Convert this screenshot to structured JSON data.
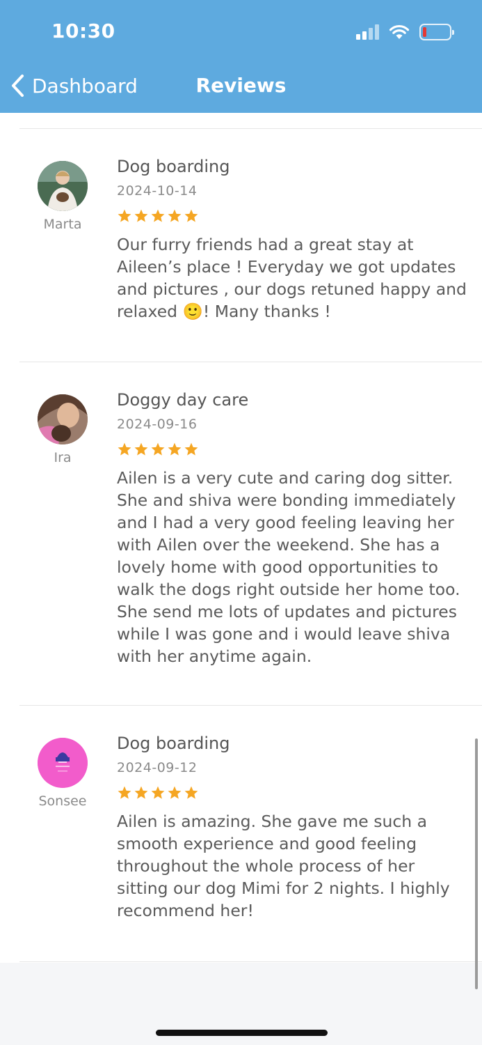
{
  "colors": {
    "accent": "#5eaadf",
    "star": "#f5a623"
  },
  "status_bar": {
    "time": "10:30",
    "icons": [
      "cellular-signal-icon",
      "wifi-icon",
      "battery-low-icon"
    ]
  },
  "nav": {
    "back_label": "Dashboard",
    "title": "Reviews"
  },
  "reviews": [
    {
      "name": "Marta",
      "service": "Dog boarding",
      "date": "2024-10-14",
      "rating": 5,
      "text": "Our furry friends had a great stay at Aileen’s place ! Everyday we got updates and  pictures , our dogs retuned happy and relaxed 🙂!  Many thanks !"
    },
    {
      "name": "Ira",
      "service": "Doggy day care",
      "date": "2024-09-16",
      "rating": 5,
      "text": "Ailen is a very cute and caring dog sitter. She and shiva were bonding immediately and I had a very good feeling leaving her with Ailen over the weekend. She has a lovely home with good opportunities to walk the dogs right outside her home too. She send me lots of updates and pictures while I was gone and i would leave shiva with her anytime again."
    },
    {
      "name": "Sonsee",
      "service": "Dog boarding",
      "date": "2024-09-12",
      "rating": 5,
      "text": "Ailen is amazing. She gave me such a smooth experience and good feeling throughout the whole process of her sitting our dog Mimi for 2 nights. I highly recommend her!"
    }
  ]
}
